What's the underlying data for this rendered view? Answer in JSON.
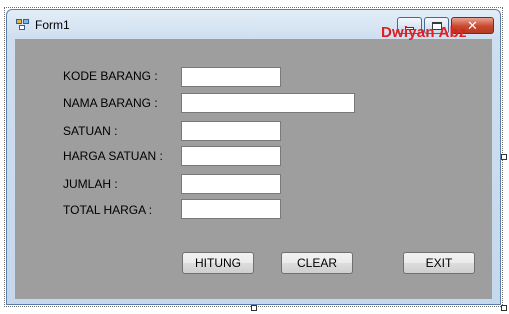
{
  "window": {
    "title": "Form1",
    "watermark": "Dwiyan Abz"
  },
  "form": {
    "fields": [
      {
        "label": "KODE BARANG :",
        "value": ""
      },
      {
        "label": "NAMA BARANG :",
        "value": ""
      },
      {
        "label": "SATUAN :",
        "value": ""
      },
      {
        "label": "HARGA SATUAN :",
        "value": ""
      },
      {
        "label": "JUMLAH :",
        "value": ""
      },
      {
        "label": "TOTAL HARGA :",
        "value": ""
      }
    ]
  },
  "buttons": {
    "hitung": "HITUNG",
    "clear": "CLEAR",
    "exit": "EXIT"
  }
}
